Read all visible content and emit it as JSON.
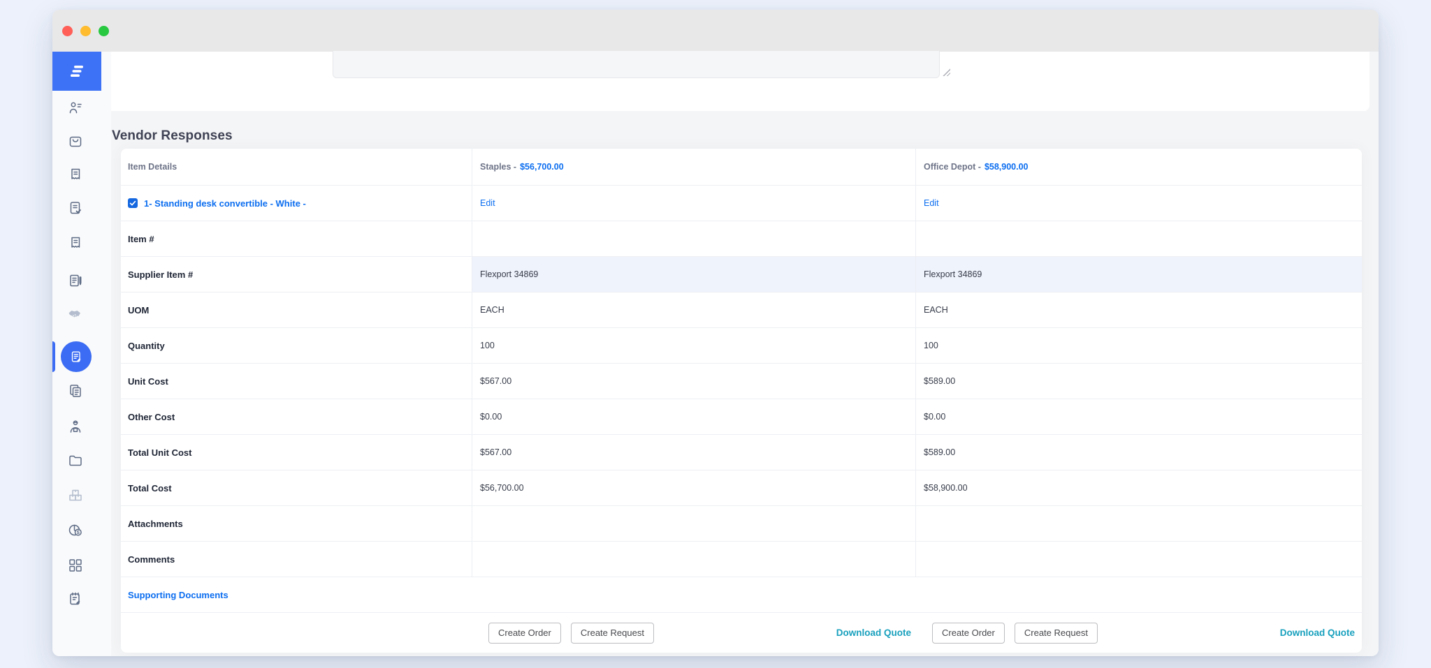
{
  "window": {
    "traffic_lights": [
      {
        "name": "close",
        "color": "#ff5f57"
      },
      {
        "name": "minimize",
        "color": "#febc2e"
      },
      {
        "name": "zoom",
        "color": "#28c840"
      }
    ]
  },
  "sidebar": {
    "logo_color": "#3e72f6",
    "items": [
      {
        "icon": "users-icon"
      },
      {
        "icon": "shopping-bag-icon"
      },
      {
        "icon": "invoice-icon"
      },
      {
        "icon": "document-check-icon"
      },
      {
        "icon": "receipt-icon"
      },
      {
        "icon": "notepad-pen-icon"
      },
      {
        "icon": "handshake-icon",
        "muted": true
      },
      {
        "icon": "document-edit-icon",
        "active": true
      },
      {
        "icon": "copy-documents-icon"
      },
      {
        "icon": "delivery-person-icon"
      },
      {
        "icon": "folder-icon"
      },
      {
        "icon": "inventory-boxes-icon",
        "muted": true
      },
      {
        "icon": "pie-chart-dollar-icon"
      },
      {
        "icon": "apps-grid-icon"
      },
      {
        "icon": "notepad-edit-icon"
      }
    ]
  },
  "form": {
    "notes_value": ""
  },
  "page": {
    "heading": "Vendor Responses"
  },
  "comparison": {
    "columns": {
      "item_details": "Item Details"
    },
    "vendors": [
      {
        "label": "Staples -",
        "total": "$56,700.00"
      },
      {
        "label": "Office Depot -",
        "total": "$58,900.00"
      }
    ],
    "item": {
      "checked": true,
      "name": "1- Standing desk convertible - White -",
      "edit_label": "Edit"
    },
    "rows": [
      {
        "label": "Item #",
        "values": [
          "",
          ""
        ]
      },
      {
        "label": "Supplier Item #",
        "values": [
          "Flexport 34869",
          "Flexport 34869"
        ],
        "highlight": true
      },
      {
        "label": "UOM",
        "values": [
          "EACH",
          "EACH"
        ]
      },
      {
        "label": "Quantity",
        "values": [
          "100",
          "100"
        ]
      },
      {
        "label": "Unit Cost",
        "values": [
          "$567.00",
          "$589.00"
        ]
      },
      {
        "label": "Other Cost",
        "values": [
          "$0.00",
          "$0.00"
        ]
      },
      {
        "label": "Total Unit Cost",
        "values": [
          "$567.00",
          "$589.00"
        ]
      },
      {
        "label": "Total Cost",
        "values": [
          "$56,700.00",
          "$58,900.00"
        ]
      },
      {
        "label": "Attachments",
        "values": [
          "",
          ""
        ]
      },
      {
        "label": "Comments",
        "values": [
          "",
          ""
        ]
      }
    ],
    "supporting_documents_label": "Supporting Documents",
    "footer": {
      "create_order": "Create Order",
      "create_request": "Create Request",
      "download_quote": "Download Quote"
    }
  },
  "colors": {
    "accent_blue": "#0c6ef0",
    "teal": "#18a0bd",
    "active_nav": "#3b6cf3",
    "logo_blue": "#3e72f6",
    "highlight_row": "#eff3fc",
    "titlebar": "#e8e8e9"
  }
}
